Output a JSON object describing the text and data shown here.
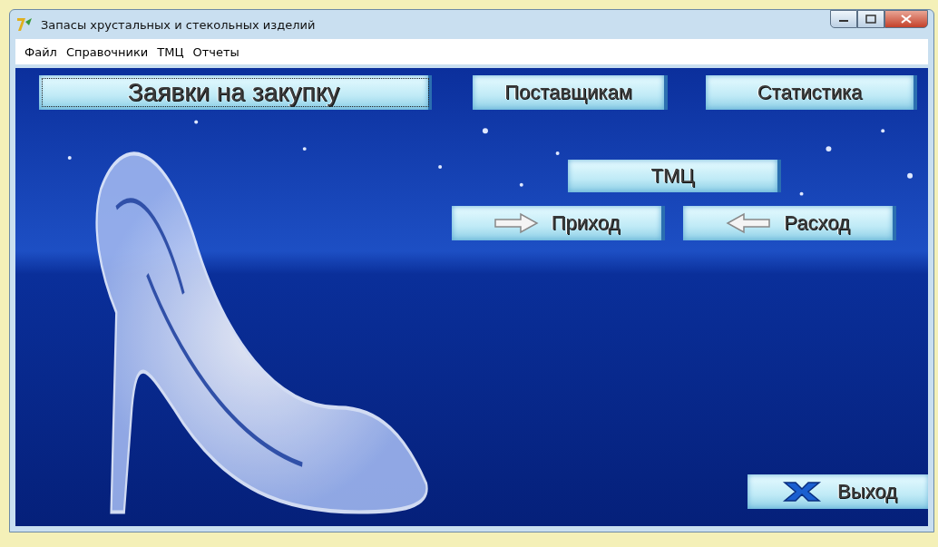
{
  "window": {
    "title": "Запасы хрустальных и стекольных изделий"
  },
  "menu": [
    {
      "label": "Файл"
    },
    {
      "label": "Справочники"
    },
    {
      "label": "ТМЦ"
    },
    {
      "label": "Отчеты"
    }
  ],
  "buttons": [
    {
      "label": "Заявки на закупку",
      "kind": "plain",
      "focused": true
    },
    {
      "label": "Поставщикам",
      "kind": "plain",
      "focused": false
    },
    {
      "label": "Статистика",
      "kind": "plain",
      "focused": false
    },
    {
      "label": "ТМЦ",
      "kind": "plain",
      "focused": false
    },
    {
      "label": "Приход",
      "kind": "arrow-right",
      "focused": false
    },
    {
      "label": "Расход",
      "kind": "arrow-left",
      "focused": false
    },
    {
      "label": "Выход",
      "kind": "exit",
      "focused": false
    }
  ]
}
